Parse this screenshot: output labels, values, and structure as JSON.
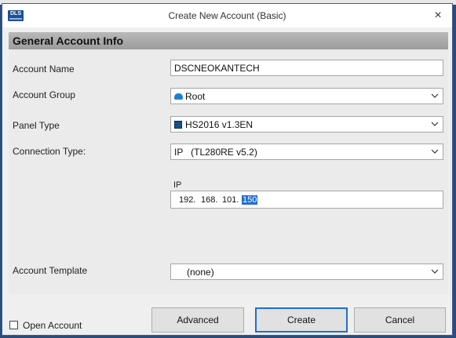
{
  "window": {
    "title": "Create New Account (Basic)",
    "icon_text": "DLS",
    "close_glyph": "×"
  },
  "section": {
    "header": "General Account Info"
  },
  "form": {
    "account_name": {
      "label": "Account Name",
      "value": "DSCNEOKANTECH"
    },
    "account_group": {
      "label": "Account Group",
      "value": "Root",
      "icon": "root-folder-icon"
    },
    "panel_type": {
      "label": "Panel Type",
      "value": "HS2016 v1.3EN",
      "icon": "panel-icon"
    },
    "connection_type": {
      "label": "Connection Type:",
      "value": "IP   (TL280RE v5.2)"
    },
    "ip": {
      "label": "IP",
      "octets": [
        "192.",
        "168.",
        "101.",
        "150"
      ],
      "selected_octet_index": 3
    },
    "account_template": {
      "label": "Account Template",
      "value": "(none)"
    }
  },
  "footer": {
    "open_account": {
      "label": "Open Account",
      "checked": false
    },
    "buttons": {
      "advanced": "Advanced",
      "create": "Create",
      "cancel": "Cancel"
    }
  },
  "colors": {
    "accent": "#1f6fd0",
    "section_header": "#a9a9a9",
    "window_border": "#3b5f95"
  }
}
